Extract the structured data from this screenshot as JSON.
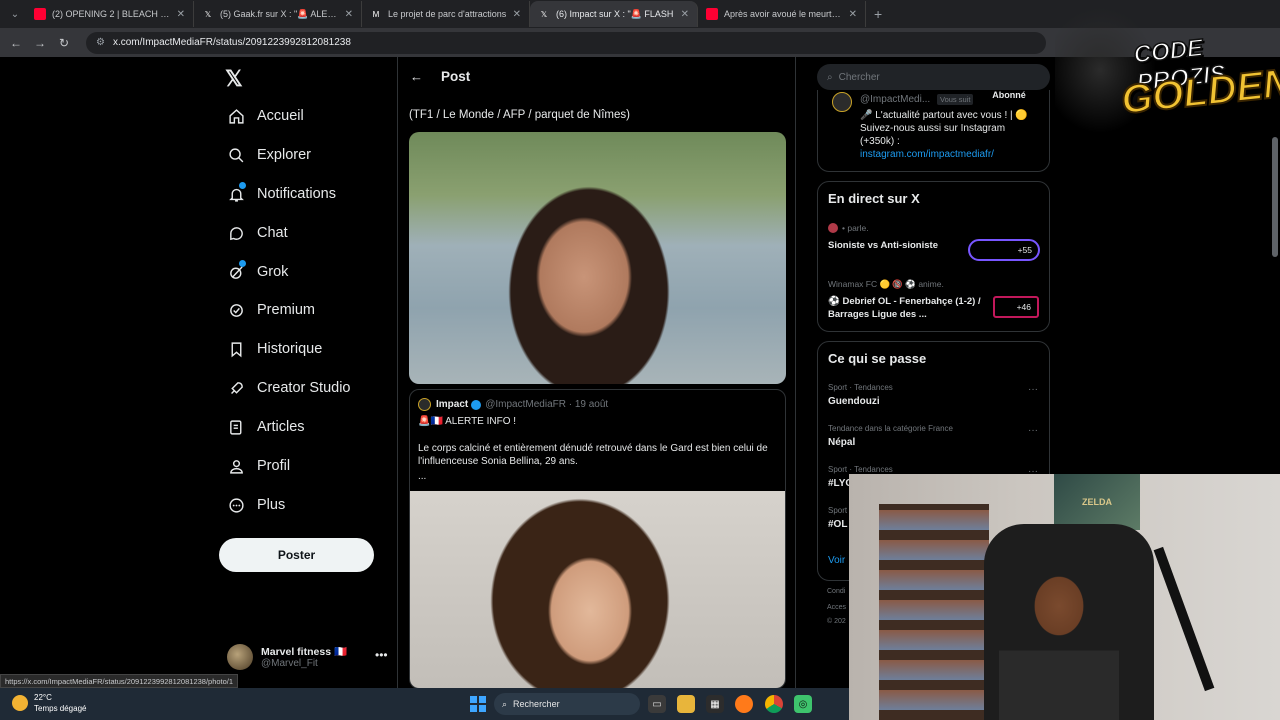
{
  "browser": {
    "tabs": [
      {
        "title": "(2) OPENING 2 | BLEACH | D-te",
        "fav_color": "#ff0033",
        "active": false
      },
      {
        "title": "(5) Gaak.fr sur X : \"🚨 ALERTE :",
        "fav_color": "#ffffff",
        "active": false
      },
      {
        "title": "Le projet de parc d'attractions",
        "fav_color": "#ffffff",
        "active": false
      },
      {
        "title": "(6) Impact sur X : \"🚨 FLASH",
        "fav_color": "#ffffff",
        "active": true
      },
      {
        "title": "Après avoir avoué le meurtre d",
        "fav_color": "#ff0033",
        "active": false
      }
    ],
    "url": "x.com/ImpactMediaFR/status/2091223992812081238",
    "status_url": "https://x.com/ImpactMediaFR/status/2091223992812081238/photo/1"
  },
  "nav": {
    "logo": "𝕏",
    "items": [
      {
        "label": "Accueil",
        "icon": "home-icon"
      },
      {
        "label": "Explorer",
        "icon": "search-icon"
      },
      {
        "label": "Notifications",
        "icon": "bell-icon"
      },
      {
        "label": "Chat",
        "icon": "chat-icon"
      },
      {
        "label": "Grok",
        "icon": "grok-icon"
      },
      {
        "label": "Premium",
        "icon": "verified-icon"
      },
      {
        "label": "Historique",
        "icon": "bookmark-icon"
      },
      {
        "label": "Creator Studio",
        "icon": "rocket-icon"
      },
      {
        "label": "Articles",
        "icon": "article-icon"
      },
      {
        "label": "Profil",
        "icon": "user-icon"
      },
      {
        "label": "Plus",
        "icon": "more-circle-icon"
      }
    ],
    "post_button": "Poster",
    "account": {
      "name": "Marvel fitness 🇫🇷",
      "handle": "@Marvel_Fit"
    }
  },
  "post": {
    "header_title": "Post",
    "caption": "(TF1 / Le Monde / AFP / parquet de Nîmes)",
    "quote": {
      "name": "Impact",
      "handle": "@ImpactMediaFR · 19 août",
      "line1": "🚨🇫🇷 ALERTE INFO !",
      "line2": "Le corps calciné et entièrement dénudé retrouvé dans le Gard est bien celui de l'influenceuse Sonia Bellina, 29 ans.",
      "line3": "..."
    }
  },
  "right": {
    "search_placeholder": "Chercher",
    "profile_card": {
      "handle": "@ImpactMedi...",
      "follows_you": "Vous suit",
      "follow_btn": "Abonné",
      "bio1": "🎤 L'actualité partout avec vous ! | 🟡",
      "bio2": "Suivez-nous aussi sur Instagram",
      "bio3": "(+350k) :",
      "link": "instagram.com/impactmediafr/"
    },
    "live": {
      "title": "En direct sur X",
      "items": [
        {
          "meta": "• parle.",
          "title": "Sioniste vs Anti-sioniste",
          "count": "+55"
        },
        {
          "meta": "Winamax FC 🟡 🔞 ⚽ anime.",
          "title": "⚽ Debrief OL - Fenerbahçe (1-2) / Barrages Ligue des ...",
          "count": "+46"
        }
      ]
    },
    "trends": {
      "title": "Ce qui se passe",
      "items": [
        {
          "meta": "Sport · Tendances",
          "name": "Guendouzi"
        },
        {
          "meta": "Tendance dans la catégorie France",
          "name": "Népal"
        },
        {
          "meta": "Sport · Tendances",
          "name": "#LYO"
        },
        {
          "meta": "Sport",
          "name": "#OL"
        }
      ],
      "show_more": "Voir",
      "footer1": "Condi",
      "footer2": "Acces",
      "footer3": "© 202"
    }
  },
  "overlay": {
    "line1": "CODE PROZIS",
    "line2": "GOLDENG"
  },
  "webcam": {
    "poster_text": "ZELDA"
  },
  "taskbar": {
    "temp": "22°C",
    "weather": "Temps dégagé",
    "search": "Rechercher"
  }
}
